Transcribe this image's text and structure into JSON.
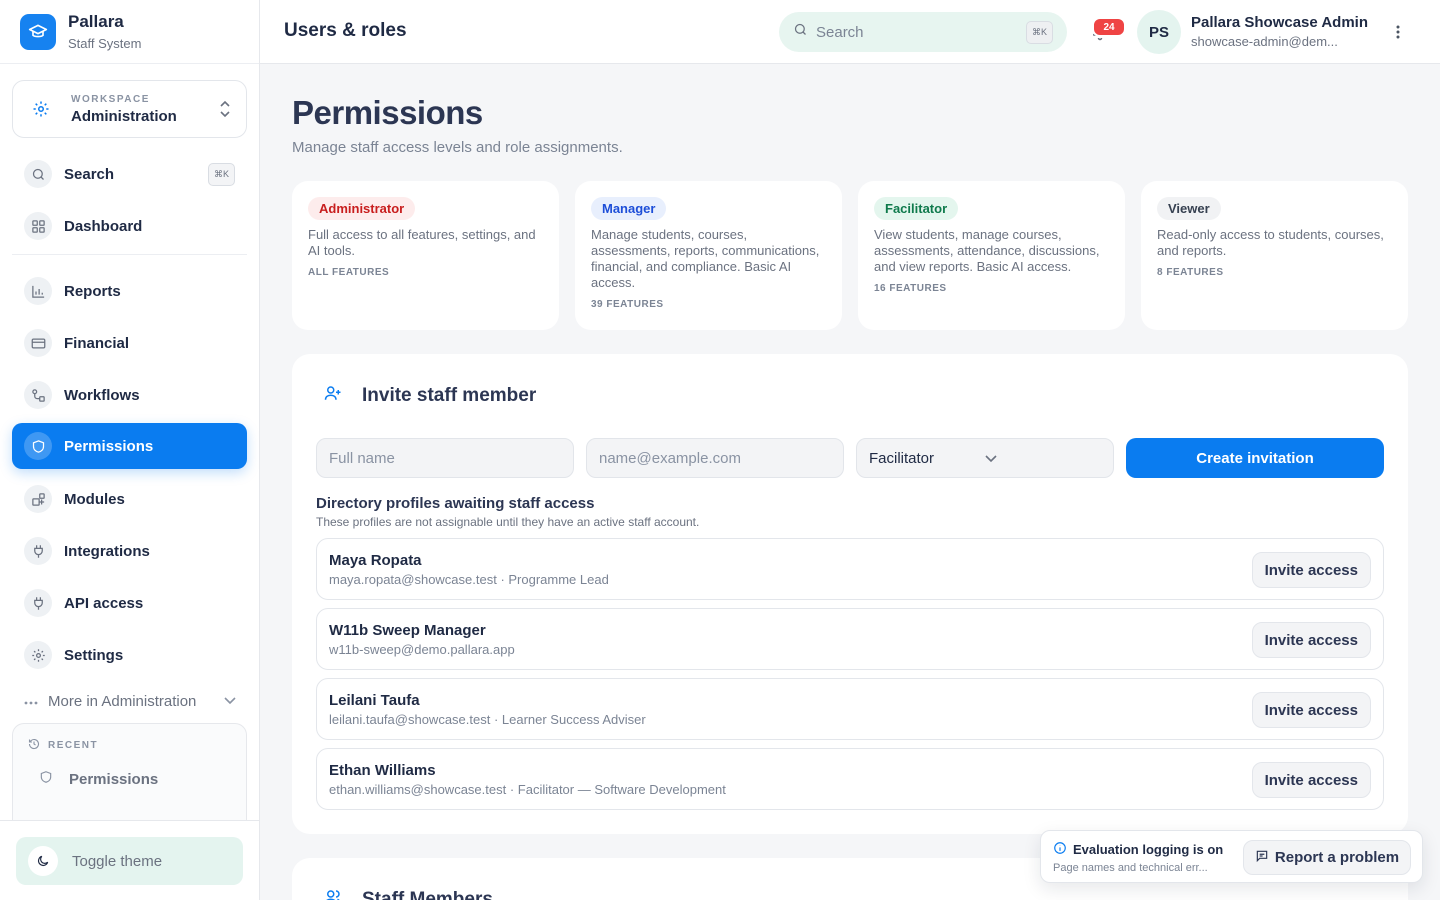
{
  "brand": {
    "name": "Pallara",
    "subtitle": "Staff System"
  },
  "workspace": {
    "label": "WORKSPACE",
    "value": "Administration"
  },
  "sidebar": {
    "search": {
      "label": "Search",
      "shortcut": "⌘K"
    },
    "items": [
      {
        "label": "Dashboard",
        "icon": "grid-icon"
      },
      {
        "label": "Reports",
        "icon": "bar-chart-icon"
      },
      {
        "label": "Financial",
        "icon": "credit-card-icon"
      },
      {
        "label": "Workflows",
        "icon": "workflow-icon"
      },
      {
        "label": "Permissions",
        "icon": "shield-icon",
        "active": true
      },
      {
        "label": "Modules",
        "icon": "modules-icon"
      },
      {
        "label": "Integrations",
        "icon": "plug-icon"
      },
      {
        "label": "API access",
        "icon": "plug-icon"
      },
      {
        "label": "Settings",
        "icon": "gear-icon"
      }
    ],
    "more_label": "More in Administration",
    "recent": {
      "label": "RECENT",
      "items": [
        "Permissions"
      ]
    },
    "toggle_theme": "Toggle theme"
  },
  "topbar": {
    "heading": "Users & roles",
    "search_placeholder": "Search",
    "search_shortcut": "⌘K",
    "notifications": "24",
    "avatar_initials": "PS",
    "user_name": "Pallara Showcase Admin",
    "user_email": "showcase-admin@dem..."
  },
  "page": {
    "title": "Permissions",
    "subtitle": "Manage staff access levels and role assignments."
  },
  "roles": [
    {
      "name": "Administrator",
      "description": "Full access to all features, settings, and AI tools.",
      "count": "ALL FEATURES",
      "color": "#c81e1e",
      "bg": "#fdecec"
    },
    {
      "name": "Manager",
      "description": "Manage students, courses, assessments, reports, communications, financial, and compliance. Basic AI access.",
      "count": "39 FEATURES",
      "color": "#1d4ed8",
      "bg": "#e8effd"
    },
    {
      "name": "Facilitator",
      "description": "View students, manage courses, assessments, attendance, discussions, and view reports. Basic AI access.",
      "count": "16 FEATURES",
      "color": "#0f7a4c",
      "bg": "#e4f6ee"
    },
    {
      "name": "Viewer",
      "description": "Read-only access to students, courses, and reports.",
      "count": "8 FEATURES",
      "color": "#374151",
      "bg": "#f1f2f4"
    }
  ],
  "invite": {
    "title": "Invite staff member",
    "name_placeholder": "Full name",
    "email_placeholder": "name@example.com",
    "role_selected": "Facilitator",
    "create_label": "Create invitation",
    "directory_title": "Directory profiles awaiting staff access",
    "directory_subtitle": "These profiles are not assignable until they have an active staff account.",
    "invite_label": "Invite access",
    "profiles": [
      {
        "name": "Maya Ropata",
        "meta": "maya.ropata@showcase.test · Programme Lead"
      },
      {
        "name": "W11b Sweep Manager",
        "meta": "w11b-sweep@demo.pallara.app"
      },
      {
        "name": "Leilani Taufa",
        "meta": "leilani.taufa@showcase.test · Learner Success Adviser"
      },
      {
        "name": "Ethan Williams",
        "meta": "ethan.williams@showcase.test · Facilitator — Software Development"
      }
    ]
  },
  "staff": {
    "title": "Staff Members"
  },
  "toast": {
    "title": "Evaluation logging is on",
    "description": "Page names and technical err...",
    "report_label": "Report a problem"
  },
  "colors": {
    "accent": "#0a7cf0",
    "danger": "#ef4444",
    "mint": "#e4f4ef"
  }
}
